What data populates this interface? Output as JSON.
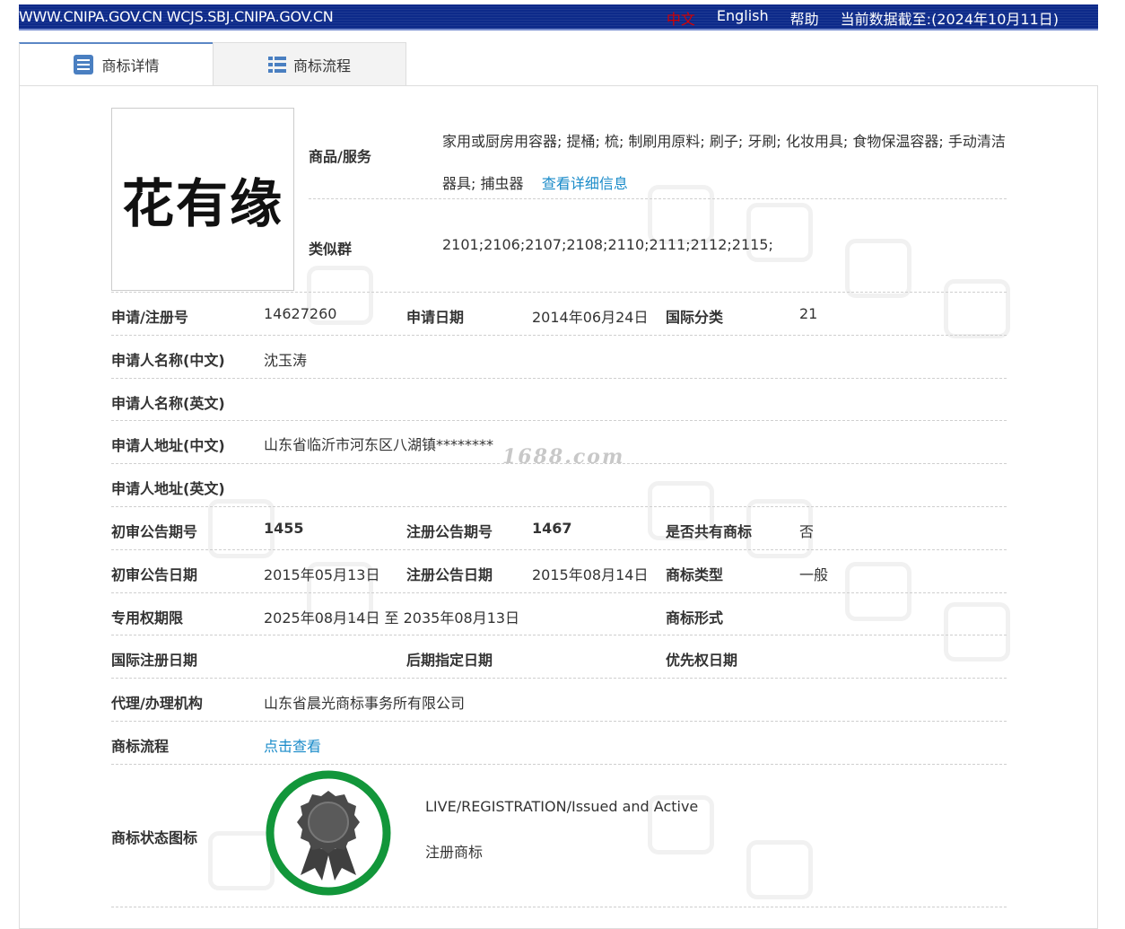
{
  "header": {
    "domains": "WWW.CNIPA.GOV.CN WCJS.SBJ.CNIPA.GOV.CN",
    "lang_zh": "中文",
    "lang_en": "English",
    "help": "帮助",
    "data_date": "当前数据截至:(2024年10月11日)"
  },
  "tabs": [
    {
      "label": "商标详情",
      "icon": "document-list-icon"
    },
    {
      "label": "商标流程",
      "icon": "list-icon"
    }
  ],
  "trademark": {
    "logo_text": "花有缘",
    "goods_label": "商品/服务",
    "goods_value": "家用或厨房用容器; 提桶; 梳; 制刷用原料; 刷子; 牙刷; 化妆用具; 食物保温容器; 手动清洁器具; 捕虫器",
    "goods_link": "查看详细信息",
    "similar_label": "类似群",
    "similar_value": "2101;2106;2107;2108;2110;2111;2112;2115;"
  },
  "fields": {
    "reg_no_label": "申请/注册号",
    "reg_no": "14627260",
    "app_date_label": "申请日期",
    "app_date": "2014年06月24日",
    "intl_class_label": "国际分类",
    "intl_class": "21",
    "applicant_cn_label": "申请人名称(中文)",
    "applicant_cn": "沈玉涛",
    "applicant_en_label": "申请人名称(英文)",
    "applicant_en": "",
    "address_cn_label": "申请人地址(中文)",
    "address_cn": "山东省临沂市河东区八湖镇********",
    "address_en_label": "申请人地址(英文)",
    "address_en": "",
    "prelim_no_label": "初审公告期号",
    "prelim_no": "1455",
    "reg_pub_no_label": "注册公告期号",
    "reg_pub_no": "1467",
    "shared_label": "是否共有商标",
    "shared": "否",
    "prelim_date_label": "初审公告日期",
    "prelim_date": "2015年05月13日",
    "reg_pub_date_label": "注册公告日期",
    "reg_pub_date": "2015年08月14日",
    "tm_type_label": "商标类型",
    "tm_type": "一般",
    "exclusive_label": "专用权期限",
    "exclusive": "2025年08月14日 至 2035年08月13日",
    "tm_form_label": "商标形式",
    "tm_form": "",
    "intl_reg_date_label": "国际注册日期",
    "intl_reg_date": "",
    "later_date_label": "后期指定日期",
    "later_date": "",
    "priority_date_label": "优先权日期",
    "priority_date": "",
    "agent_label": "代理/办理机构",
    "agent": "山东省晨光商标事务所有限公司",
    "flow_label": "商标流程",
    "flow_link": "点击查看",
    "status_label": "商标状态图标",
    "status_en": "LIVE/REGISTRATION/Issued and Active",
    "status_cn": "注册商标"
  },
  "watermark": "1688.com",
  "colors": {
    "banner": "#0d2a8a",
    "link": "#1a8bc9",
    "status_ring": "#12963a",
    "badge": "#4a4a4a"
  }
}
